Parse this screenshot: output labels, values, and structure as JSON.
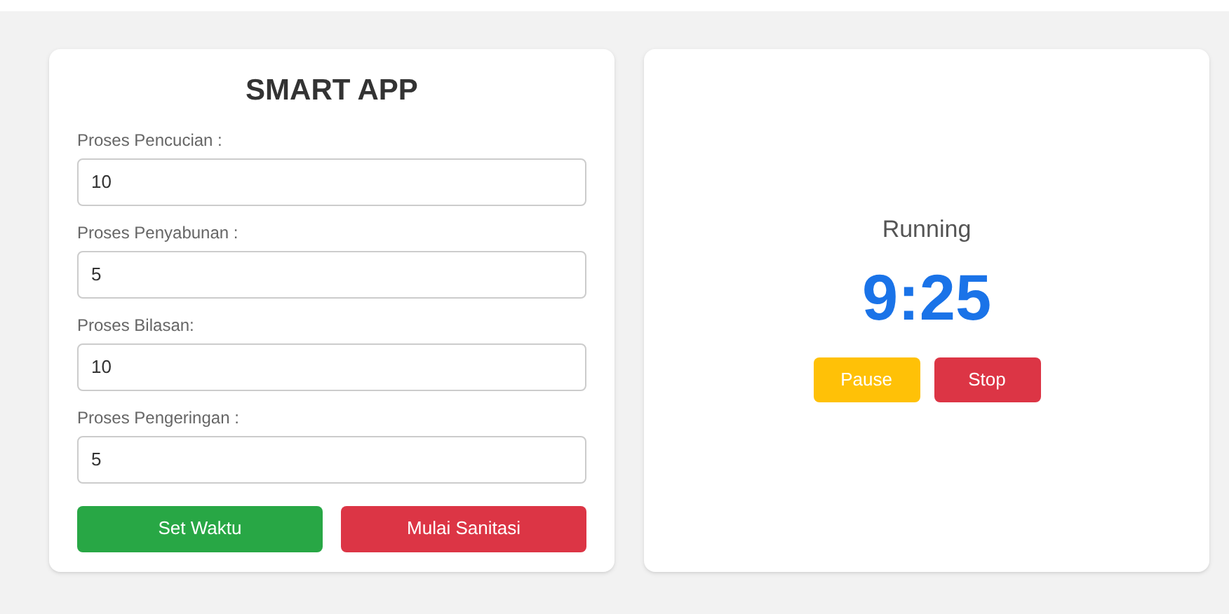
{
  "form_card": {
    "title": "SMART APP",
    "fields": [
      {
        "label": "Proses Pencucian :",
        "value": "10"
      },
      {
        "label": "Proses Penyabunan :",
        "value": "5"
      },
      {
        "label": "Proses Bilasan:",
        "value": "10"
      },
      {
        "label": "Proses Pengeringan :",
        "value": "5"
      }
    ],
    "buttons": [
      {
        "label": "Set Waktu",
        "kind": "success"
      },
      {
        "label": "Mulai Sanitasi",
        "kind": "danger"
      }
    ]
  },
  "timer_card": {
    "status": "Running",
    "time": "9:25",
    "buttons": [
      {
        "label": "Pause",
        "kind": "warning"
      },
      {
        "label": "Stop",
        "kind": "danger"
      }
    ]
  }
}
